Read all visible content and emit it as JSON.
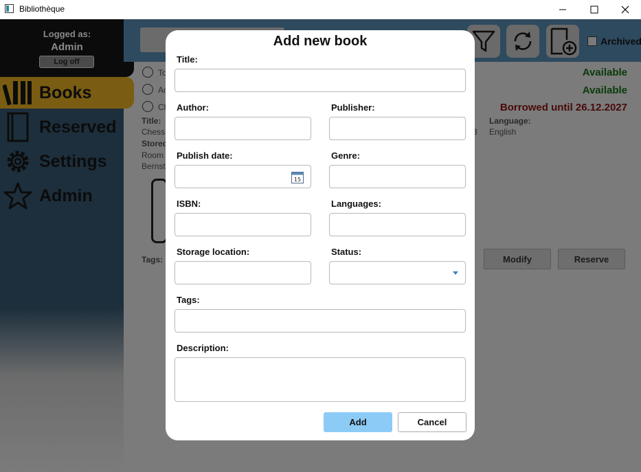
{
  "window": {
    "title": "Bibliothèque",
    "controls": {
      "minimize": "—",
      "maximize": "☐",
      "close": "✕"
    }
  },
  "sidebar": {
    "logged_label": "Logged as:",
    "user": "Admin",
    "logoff_label": "Log off",
    "items": [
      {
        "label": "Books",
        "icon": "books-icon",
        "active": true
      },
      {
        "label": "Reserved",
        "icon": "book-icon",
        "active": false
      },
      {
        "label": "Settings",
        "icon": "gear-icon",
        "active": false
      },
      {
        "label": "Admin",
        "icon": "star-icon",
        "active": false
      }
    ]
  },
  "toolbar": {
    "archived_label": "Archived"
  },
  "book_list": {
    "statuses": [
      "Available",
      "Available",
      "Borrowed until 26.12.2027"
    ],
    "row_fragments": [
      "To",
      "Ac",
      "Ch"
    ],
    "detail": {
      "title_label": "Title:",
      "title_value": "Chess",
      "stored_label": "Stored",
      "stored_value_1": "Room",
      "stored_value_2": "Bernst",
      "language_label": "Language:",
      "language_value": "English",
      "digit_fragment": "3",
      "tags_label": "Tags:"
    },
    "buttons": {
      "modify": "Modify",
      "reserve": "Reserve"
    }
  },
  "dialog": {
    "title": "Add new book",
    "labels": {
      "title": "Title:",
      "author": "Author:",
      "publisher": "Publisher:",
      "publish_date": "Publish date:",
      "genre": "Genre:",
      "isbn": "ISBN:",
      "languages": "Languages:",
      "storage_location": "Storage location:",
      "status": "Status:",
      "tags": "Tags:",
      "description": "Description:"
    },
    "values": {
      "title": "",
      "author": "",
      "publisher": "",
      "publish_date": "",
      "genre": "",
      "isbn": "",
      "languages": "",
      "storage_location": "",
      "status": "",
      "tags": "",
      "description": ""
    },
    "calendar_day": "15",
    "add_label": "Add",
    "cancel_label": "Cancel",
    "colors": {
      "primary": "#8ccbf6",
      "dropdown_arrow": "#3b82c4"
    }
  }
}
